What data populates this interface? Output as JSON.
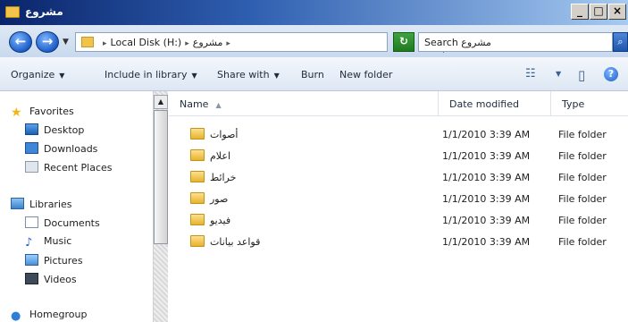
{
  "window": {
    "title": "مشروع",
    "buttons": {
      "minimize": "_",
      "maximize": "□",
      "close": "×"
    }
  },
  "address": {
    "nav_back": "←",
    "nav_forward": "→",
    "nav_dropdown": "▼",
    "crumbs": [
      "Local Disk (H:)",
      "مشروع"
    ],
    "crumb_separator": "▸",
    "dropdown": "▼",
    "refresh": "↻"
  },
  "search": {
    "placeholder": "Search مشروع",
    "button_glyph": "⌕"
  },
  "toolbar": {
    "items": [
      {
        "label": "Organize",
        "has_caret": true
      },
      {
        "label": "Include in library",
        "has_caret": true
      },
      {
        "label": "Share with",
        "has_caret": true
      },
      {
        "label": "Burn",
        "has_caret": false
      },
      {
        "label": "New folder",
        "has_caret": false
      }
    ],
    "caret": "▼",
    "view_glyph": "☷",
    "view_caret": "▼",
    "preview_glyph": "▯",
    "help_glyph": "?"
  },
  "navpane": {
    "favorites": {
      "label": "Favorites",
      "icon": "star-icon",
      "glyph": "★"
    },
    "favorites_items": [
      {
        "label": "Desktop",
        "icon": "desktop-icon"
      },
      {
        "label": "Downloads",
        "icon": "downloads-icon"
      },
      {
        "label": "Recent Places",
        "icon": "recent-places-icon"
      }
    ],
    "libraries": {
      "label": "Libraries",
      "icon": "libraries-icon"
    },
    "library_items": [
      {
        "label": "Documents",
        "icon": "documents-icon"
      },
      {
        "label": "Music",
        "icon": "music-icon",
        "glyph": "♪"
      },
      {
        "label": "Pictures",
        "icon": "pictures-icon"
      },
      {
        "label": "Videos",
        "icon": "videos-icon"
      }
    ],
    "homegroup": {
      "label": "Homegroup",
      "icon": "homegroup-icon",
      "glyph": "●"
    }
  },
  "scrollbar": {
    "up_glyph": "▲"
  },
  "filelist": {
    "columns": {
      "name": "Name",
      "date": "Date modified",
      "type": "Type"
    },
    "sort_glyph": "▲",
    "rows": [
      {
        "name": "أصوات",
        "date": "1/1/2010 3:39 AM",
        "type": "File folder"
      },
      {
        "name": "اعلام",
        "date": "1/1/2010 3:39 AM",
        "type": "File folder"
      },
      {
        "name": "خرائط",
        "date": "1/1/2010 3:39 AM",
        "type": "File folder"
      },
      {
        "name": "صور",
        "date": "1/1/2010 3:39 AM",
        "type": "File folder"
      },
      {
        "name": "فيديو",
        "date": "1/1/2010 3:39 AM",
        "type": "File folder"
      },
      {
        "name": "قواعد بيانات",
        "date": "1/1/2010 3:39 AM",
        "type": "File folder"
      }
    ]
  }
}
